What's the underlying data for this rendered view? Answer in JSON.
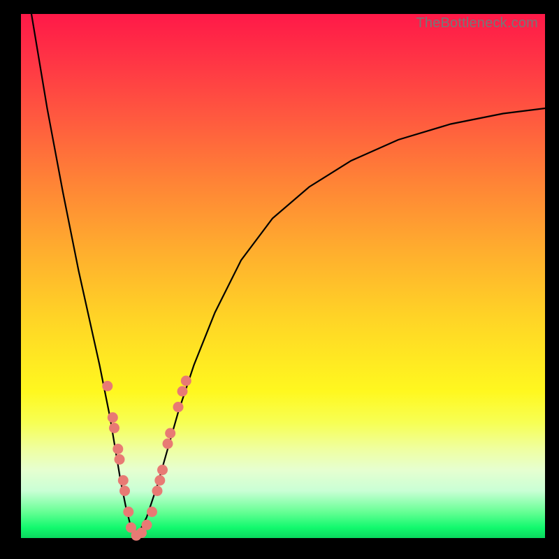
{
  "watermark": "TheBottleneck.com",
  "colors": {
    "frame": "#000000",
    "curve": "#000000",
    "dot_fill": "#e87a74",
    "dot_stroke": "#d66560"
  },
  "chart_data": {
    "type": "line",
    "title": "",
    "xlabel": "",
    "ylabel": "",
    "xlim": [
      0,
      100
    ],
    "ylim": [
      0,
      100
    ],
    "notes": "V-shaped bottleneck curve on rainbow gradient background. Left branch steep, right branch shallower asymptote. Y maps linearly to vertical gradient (0 = green bottom, 100 = red top). Minimum of curve ≈ x 22, y 0.",
    "series": [
      {
        "name": "curve-left",
        "x": [
          2,
          5,
          8,
          11,
          13,
          15,
          17,
          18,
          19,
          20,
          21,
          22
        ],
        "y": [
          100,
          82,
          66,
          51,
          42,
          33,
          23,
          17,
          11,
          6,
          2,
          0
        ]
      },
      {
        "name": "curve-right",
        "x": [
          22,
          24,
          26,
          28,
          30,
          33,
          37,
          42,
          48,
          55,
          63,
          72,
          82,
          92,
          100
        ],
        "y": [
          0,
          4,
          10,
          17,
          24,
          33,
          43,
          53,
          61,
          67,
          72,
          76,
          79,
          81,
          82
        ]
      }
    ],
    "scatter": [
      {
        "name": "dots-left-branch",
        "x": [
          16.5,
          17.5,
          17.8,
          18.5,
          18.8,
          19.5,
          19.8,
          20.5
        ],
        "y": [
          29,
          23,
          21,
          17,
          15,
          11,
          9,
          5
        ]
      },
      {
        "name": "dots-bottom",
        "x": [
          21,
          22,
          23,
          24,
          25
        ],
        "y": [
          2,
          0.5,
          1,
          2.5,
          5
        ]
      },
      {
        "name": "dots-right-branch",
        "x": [
          26,
          26.5,
          27,
          28,
          28.5,
          30,
          30.8,
          31.5
        ],
        "y": [
          9,
          11,
          13,
          18,
          20,
          25,
          28,
          30
        ]
      }
    ]
  }
}
